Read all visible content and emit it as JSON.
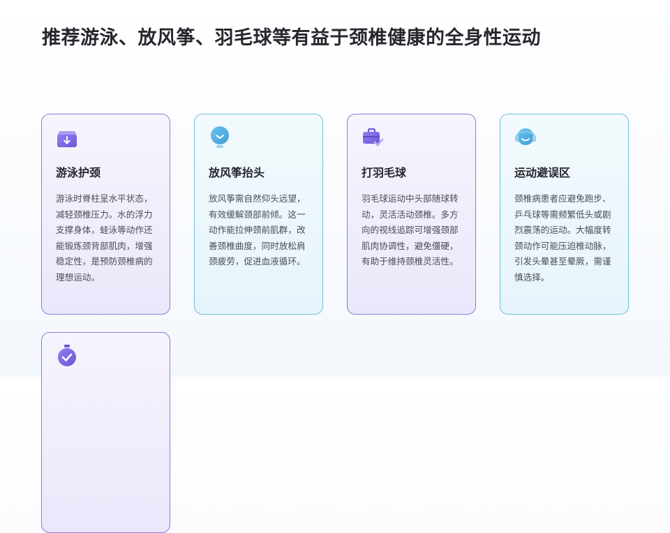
{
  "slide": {
    "title": "推荐游泳、放风筝、羽毛球等有益于颈椎健康的全身性运动"
  },
  "cards": [
    {
      "title": "游泳护颈",
      "text": "游泳时脊柱呈水平状态，减轻颈椎压力。水的浮力支撑身体，蛙泳等动作还能锻炼颈背部肌肉，增强稳定性，是预防颈椎病的理想运动。",
      "icon": "inbox-download-icon",
      "accent": "#7b6ae0"
    },
    {
      "title": "放风筝抬头",
      "text": "放风筝需自然仰头远望，有效缓解颈部前倾。这一动作能拉伸颈前肌群，改善颈椎曲度，同时放松肩颈疲劳，促进血液循环。",
      "icon": "lightbulb-icon",
      "accent": "#4fa9d8"
    },
    {
      "title": "打羽毛球",
      "text": "羽毛球运动中头部随球转动，灵活活动颈椎。多方向的视线追踪可增强颈部肌肉协调性，避免僵硬，有助于维持颈椎灵活性。",
      "icon": "briefcase-check-icon",
      "accent": "#7b6ae0"
    },
    {
      "title": "运动避误区",
      "text": "颈椎病患者应避免跑步、乒乓球等需频繁低头或剧烈震荡的运动。大幅度转颈动作可能压迫椎动脉，引发头晕甚至晕厥，需谨慎选择。",
      "icon": "headset-icon",
      "accent": "#4fa9d8"
    },
    {
      "title": "",
      "text": "",
      "icon": "stopwatch-check-icon",
      "accent": "#7b6ae0"
    }
  ]
}
